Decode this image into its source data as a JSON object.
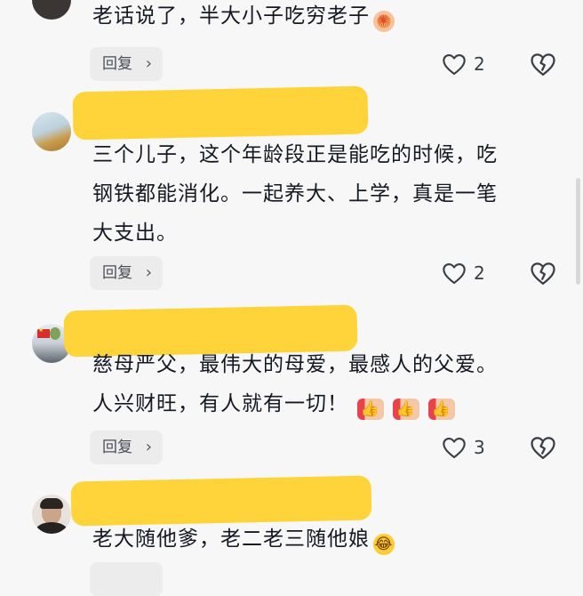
{
  "reply_label": "回复",
  "comments": [
    {
      "text": "老话说了，半大小子吃穷老子",
      "emoji": "firework-emoji",
      "likes": "2"
    },
    {
      "text": "三个儿子，这个年龄段正是能吃的时候，吃\n钢铁都能消化。一起养大、上学，真是一笔\n大支出。",
      "likes": "2"
    },
    {
      "text": "慈母严父，最伟大的母爱，最感人的父爱。\n人兴财旺，有人就有一切！",
      "emoji": "thumbs-up-emoji",
      "likes": "3"
    },
    {
      "text": "老大随他爹，老二老三随他娘",
      "emoji": "laughing-crying-emoji"
    }
  ],
  "colors": {
    "background": "#f7f7f7",
    "highlight": "#ffd43b",
    "text": "#161823",
    "reply_bg": "#ececec"
  },
  "icons": [
    "heart-icon",
    "broken-heart-icon",
    "chevron-right-icon"
  ]
}
